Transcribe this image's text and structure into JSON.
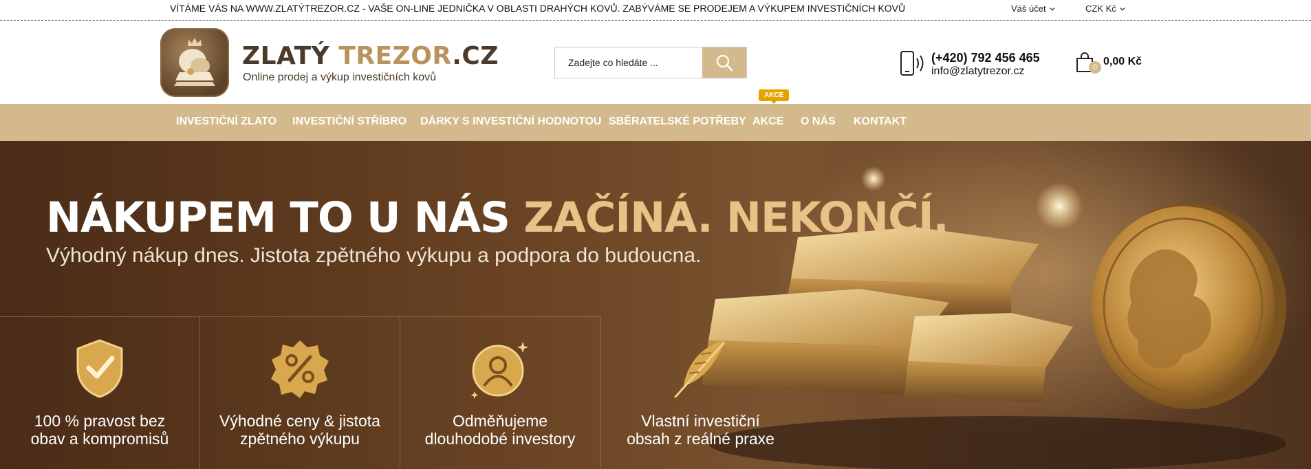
{
  "topbar": {
    "welcome": "VÍTÁME VÁS NA WWW.ZLATÝTREZOR.CZ - VAŠE ON-LINE JEDNIČKA V OBLASTI DRAHÝCH KOVŮ. ZABÝVÁME SE PRODEJEM A VÝKUPEM INVESTIČNÍCH KOVŮ",
    "account": "Váš účet",
    "currency": "CZK Kč"
  },
  "brand": {
    "name_part1": "ZLATÝ",
    "name_part2": "TREZOR",
    "name_part3": ".CZ",
    "tagline": "Online prodej a výkup investičních kovů"
  },
  "search": {
    "placeholder": "Zadejte co hledáte ..."
  },
  "contact": {
    "phone": "(+420) 792 456 465",
    "email": "info@zlatytrezor.cz"
  },
  "cart": {
    "count": "0",
    "total": "0,00 Kč"
  },
  "nav": {
    "items": [
      "INVESTIČNÍ ZLATO",
      "INVESTIČNÍ STŘÍBRO",
      "DÁRKY S INVESTIČNÍ HODNOTOU",
      "SBĚRATELSKÉ POTŘEBY",
      "AKCE",
      "O NÁS",
      "KONTAKT"
    ],
    "akce_badge": "AKCE"
  },
  "hero": {
    "title_white": "NÁKUPEM TO U NÁS ",
    "title_gold": "ZAČÍNÁ. NEKONČÍ.",
    "subtitle": "Výhodný nákup dnes. Jistota zpětného výkupu a podpora do budoucna.",
    "features": [
      {
        "icon": "shield-check-icon",
        "line1": "100 % pravost bez",
        "line2": "obav a kompromisů"
      },
      {
        "icon": "percent-badge-icon",
        "line1": "Výhodné ceny & jistota",
        "line2": "zpětného výkupu"
      },
      {
        "icon": "user-circle-icon",
        "line1": "Odměňujeme",
        "line2": "dlouhodobé investory"
      },
      {
        "icon": "feather-icon",
        "line1": "Vlastní investiční",
        "line2": "obsah z reálné praxe"
      }
    ]
  },
  "colors": {
    "gold": "#d4b98c",
    "accent_gold_text": "#e8c286",
    "badge": "#e6a300",
    "hero_dark": "#4a2c17"
  }
}
